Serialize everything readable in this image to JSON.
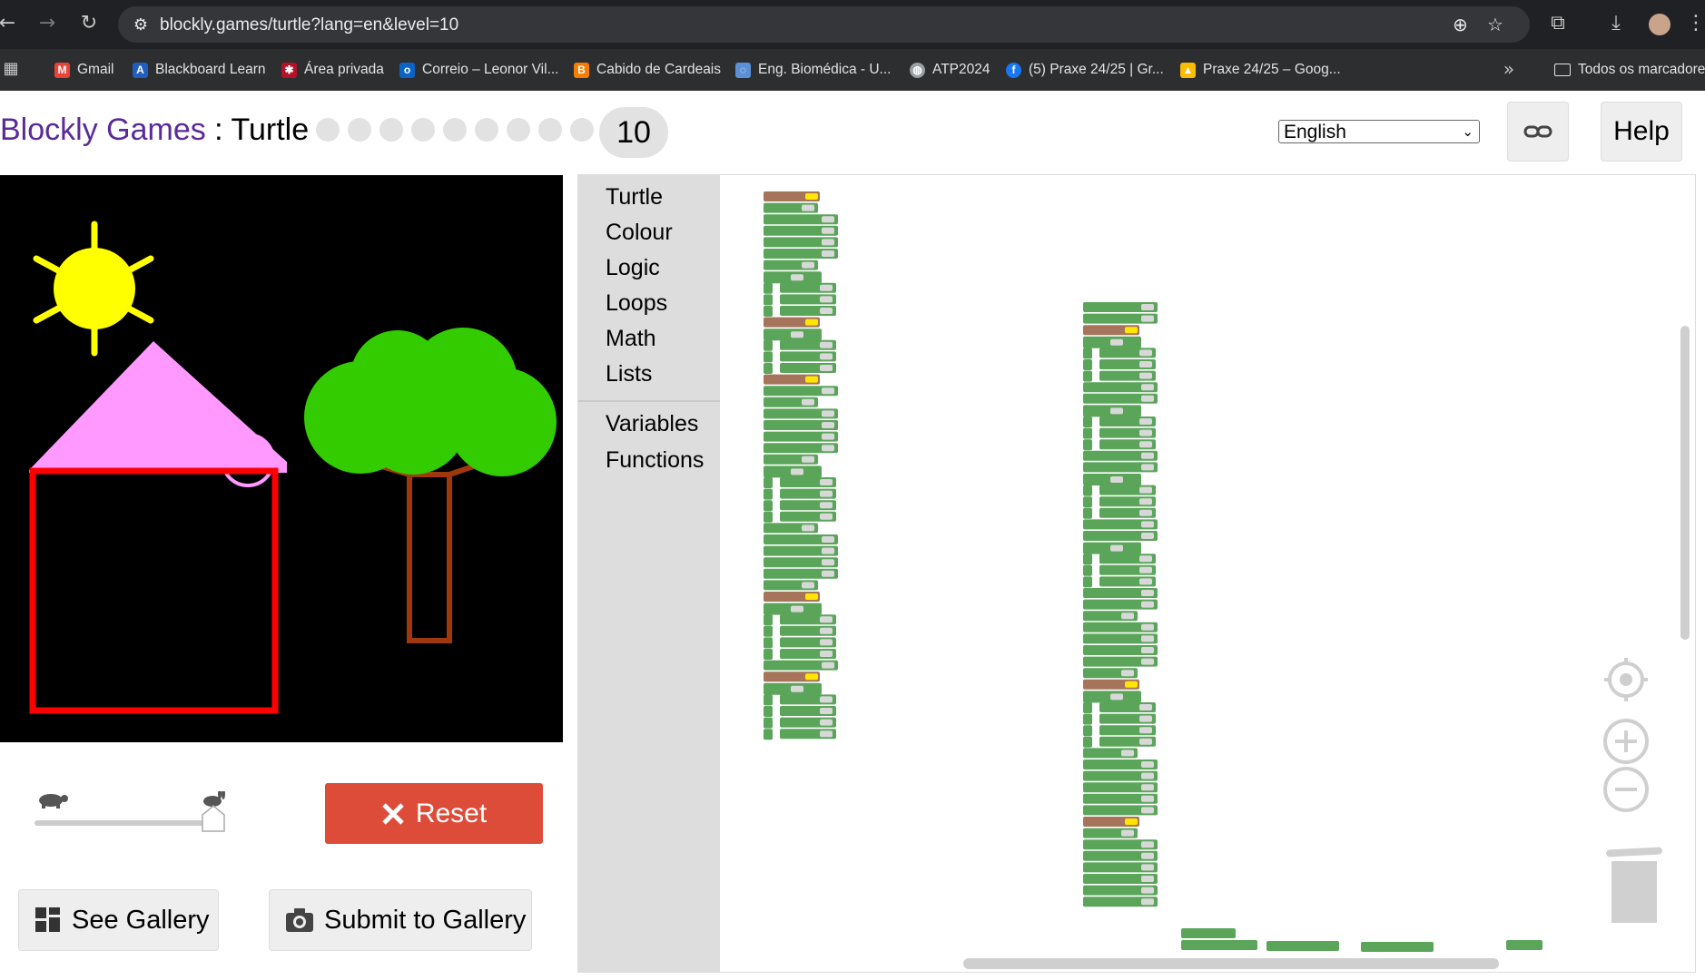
{
  "browser": {
    "url": "blockly.games/turtle?lang=en&level=10",
    "bookmarks": [
      {
        "label": "Gmail",
        "icon": "gmail-icon",
        "color": "#ea4335"
      },
      {
        "label": "Blackboard Learn",
        "icon": "blackboard-icon",
        "color": "#1f5fbf"
      },
      {
        "label": "Área privada",
        "icon": "star-logo-icon",
        "color": "#b5122a"
      },
      {
        "label": "Correio – Leonor Vil...",
        "icon": "outlook-icon",
        "color": "#0a64c8"
      },
      {
        "label": "Cabido de Cardeais",
        "icon": "blogger-icon",
        "color": "#f57d00"
      },
      {
        "label": "Eng. Biomédica - U...",
        "icon": "chat-icon",
        "color": "#5b8fd6"
      },
      {
        "label": "ATP2024",
        "icon": "globe-icon",
        "color": "#9aa0a6"
      },
      {
        "label": "(5) Praxe 24/25 | Gr...",
        "icon": "facebook-icon",
        "color": "#1877f2"
      },
      {
        "label": "Praxe 24/25 – Goog...",
        "icon": "drive-icon",
        "color": "#fbbc04"
      }
    ],
    "all_bookmarks": "Todos os marcadores"
  },
  "header": {
    "brand": "Blockly Games",
    "separator": " : ",
    "app": "Turtle",
    "level": "10",
    "total_levels": 10,
    "language": "English",
    "help": "Help"
  },
  "controls": {
    "reset": "Reset",
    "see_gallery": "See Gallery",
    "submit_gallery": "Submit to Gallery",
    "speed_fraction": 1.0
  },
  "toolbox": {
    "categories": [
      "Turtle",
      "Colour",
      "Logic",
      "Loops",
      "Math",
      "Lists"
    ],
    "extra": [
      "Variables",
      "Functions"
    ]
  },
  "colors": {
    "sun": "#ffff00",
    "roof": "#ff99ff",
    "house": "#ff0000",
    "trunk": "#a0380e",
    "foliage": "#33cc00",
    "block_turtle": "#5ba55b",
    "block_colour": "#a5745b",
    "reset": "#dd4b39"
  }
}
